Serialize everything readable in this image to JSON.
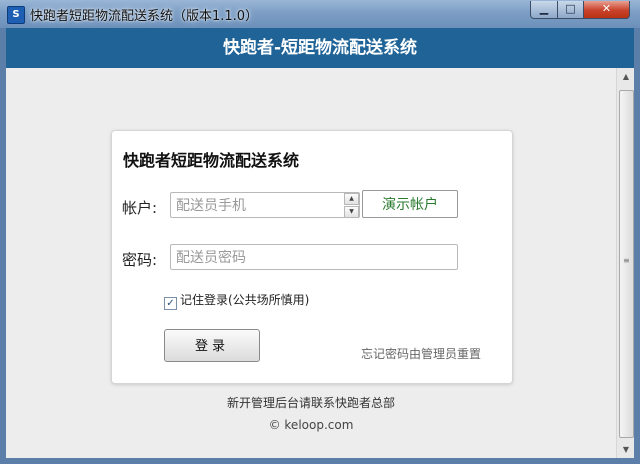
{
  "window": {
    "title": "快跑者短距物流配送系统（版本1.1.0）",
    "app_icon_text": "S"
  },
  "header": {
    "title": "快跑者-短距物流配送系统"
  },
  "login": {
    "card_title": "快跑者短距物流配送系统",
    "account_label": "帐户:",
    "account_placeholder": "配送员手机",
    "demo_button": "演示帐户",
    "password_label": "密码:",
    "password_placeholder": "配送员密码",
    "remember_checked": true,
    "remember_label": "记住登录(公共场所慎用)",
    "login_button": "登录",
    "forgot_text": "忘记密码由管理员重置"
  },
  "footer": {
    "note": "新开管理后台请联系快跑者总部",
    "copyright": "© keloop.com"
  },
  "colors": {
    "header_bg": "#1f6397",
    "demo_button_text": "#2a7a2e"
  }
}
